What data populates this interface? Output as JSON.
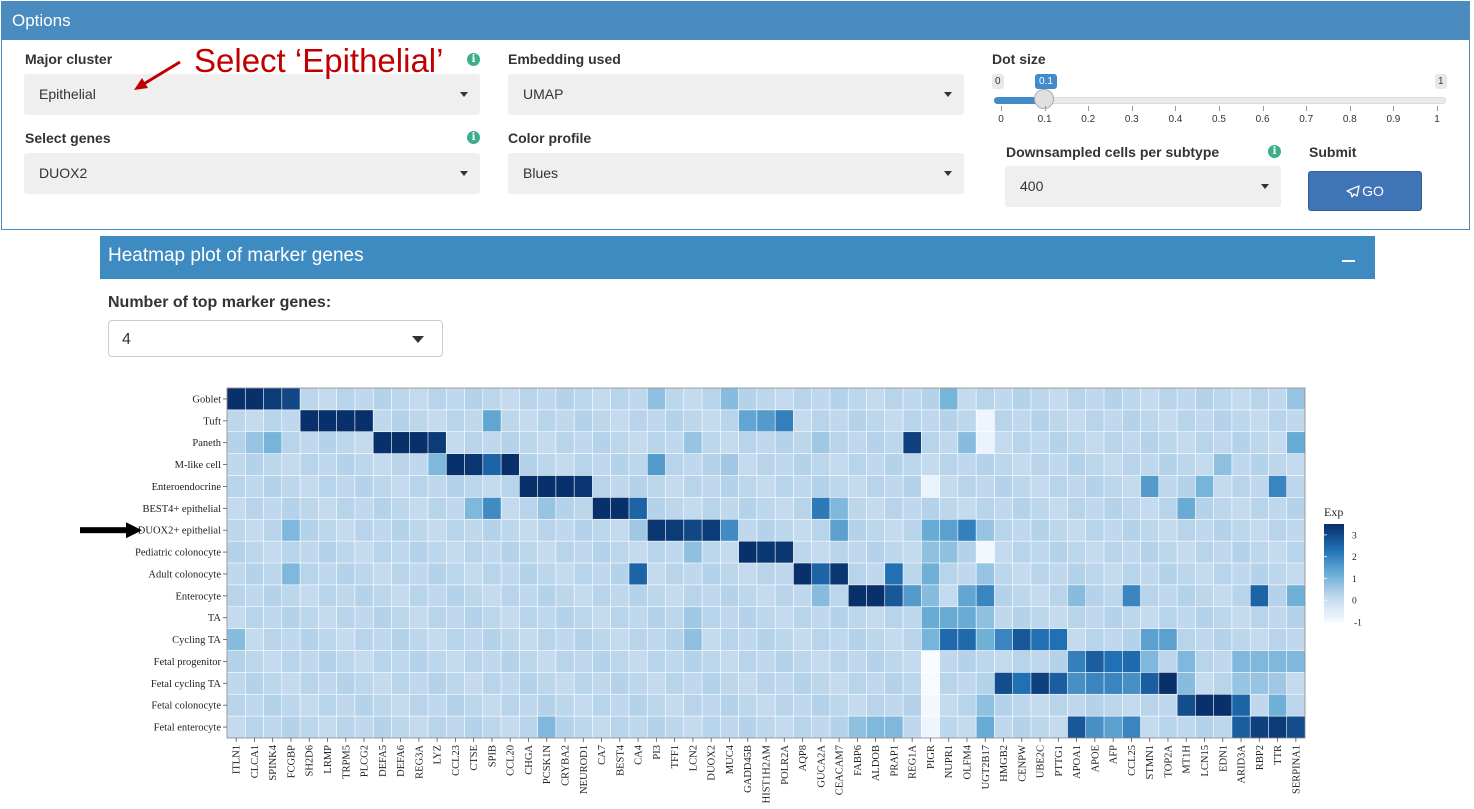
{
  "options": {
    "title": "Options",
    "major_cluster": {
      "label": "Major cluster",
      "value": "Epithelial"
    },
    "annotation": "Select ‘Epithelial’",
    "embedding": {
      "label": "Embedding used",
      "value": "UMAP"
    },
    "dot_size": {
      "label": "Dot size",
      "min": "0",
      "max": "1",
      "current": "0.1",
      "value": 0.1,
      "ticks": [
        "0",
        "0.1",
        "0.2",
        "0.3",
        "0.4",
        "0.5",
        "0.6",
        "0.7",
        "0.8",
        "0.9",
        "1"
      ]
    },
    "select_genes": {
      "label": "Select genes",
      "value": "DUOX2"
    },
    "color_profile": {
      "label": "Color profile",
      "value": "Blues"
    },
    "downsampled": {
      "label": "Downsampled cells per subtype",
      "value": "400"
    },
    "submit": {
      "label": "Submit",
      "button": "GO"
    }
  },
  "heatmap_panel": {
    "title": "Heatmap plot of marker genes",
    "top_markers": {
      "label": "Number of top marker genes:",
      "value": "4"
    }
  },
  "chart_data": {
    "type": "heatmap",
    "legend_title": "Exp",
    "legend_ticks": [
      3,
      2,
      1,
      0,
      -1
    ],
    "value_range": [
      -1,
      3.5
    ],
    "highlighted_row": "DUOX2+ epithelial",
    "rows": [
      "Goblet",
      "Tuft",
      "Paneth",
      "M-like cell",
      "Enteroendocrine",
      "BEST4+ epithelial",
      "DUOX2+ epithelial",
      "Pediatric colonocyte",
      "Adult colonocyte",
      "Enterocyte",
      "TA",
      "Cycling TA",
      "Fetal progenitor",
      "Fetal cycling TA",
      "Fetal colonocyte",
      "Fetal enterocyte"
    ],
    "columns": [
      "ITLN1",
      "CLCA1",
      "SPINK4",
      "FCGBP",
      "SH2D6",
      "LRMP",
      "TRPM5",
      "PLCG2",
      "DEFA5",
      "DEFA6",
      "REG3A",
      "LYZ",
      "CCL23",
      "CTSE",
      "SPIB",
      "CCL20",
      "CHGA",
      "PCSK1N",
      "CRYBA2",
      "NEUROD1",
      "CA7",
      "BEST4",
      "CA4",
      "PI3",
      "TFF1",
      "LCN2",
      "DUOX2",
      "MUC4",
      "GADD45B",
      "HIST1H2AM",
      "POLR2A",
      "AQP8",
      "GUCA2A",
      "CEACAM7",
      "FABP6",
      "ALDOB",
      "PRAP1",
      "REG1A",
      "PIGR",
      "NUPR1",
      "OLFM4",
      "UGT2B17",
      "HMGB2",
      "CENPW",
      "UBE2C",
      "PTTG1",
      "APOA1",
      "APOE",
      "AFP",
      "CCL25",
      "STMN1",
      "TOP2A",
      "MT1H",
      "LCN15",
      "EDN1",
      "ARID3A",
      "RBP2",
      "TTR",
      "SERPINA1"
    ],
    "high_cells": [
      [
        0,
        0,
        3.5
      ],
      [
        0,
        1,
        3.5
      ],
      [
        0,
        2,
        3.3
      ],
      [
        0,
        3,
        3.1
      ],
      [
        0,
        23,
        0.8
      ],
      [
        0,
        27,
        0.9
      ],
      [
        0,
        39,
        1.1
      ],
      [
        0,
        58,
        0.7
      ],
      [
        1,
        4,
        3.5
      ],
      [
        1,
        5,
        3.5
      ],
      [
        1,
        6,
        3.5
      ],
      [
        1,
        7,
        3.5
      ],
      [
        1,
        14,
        1.4
      ],
      [
        1,
        28,
        1.4
      ],
      [
        1,
        29,
        1.6
      ],
      [
        1,
        30,
        2.1
      ],
      [
        2,
        1,
        0.7
      ],
      [
        2,
        2,
        1.1
      ],
      [
        2,
        8,
        3.5
      ],
      [
        2,
        9,
        3.5
      ],
      [
        2,
        10,
        3.5
      ],
      [
        2,
        11,
        3.3
      ],
      [
        2,
        25,
        0.7
      ],
      [
        2,
        32,
        0.6
      ],
      [
        2,
        37,
        3.2
      ],
      [
        2,
        40,
        0.9
      ],
      [
        2,
        58,
        1.3
      ],
      [
        3,
        11,
        1.0
      ],
      [
        3,
        12,
        3.5
      ],
      [
        3,
        13,
        3.4
      ],
      [
        3,
        14,
        2.6
      ],
      [
        3,
        15,
        3.5
      ],
      [
        3,
        23,
        1.6
      ],
      [
        3,
        27,
        0.6
      ],
      [
        3,
        54,
        0.8
      ],
      [
        4,
        16,
        3.5
      ],
      [
        4,
        17,
        3.5
      ],
      [
        4,
        18,
        3.5
      ],
      [
        4,
        19,
        3.4
      ],
      [
        4,
        50,
        1.6
      ],
      [
        4,
        53,
        1.1
      ],
      [
        4,
        57,
        2.0
      ],
      [
        5,
        13,
        1.0
      ],
      [
        5,
        14,
        1.9
      ],
      [
        5,
        17,
        0.7
      ],
      [
        5,
        20,
        3.5
      ],
      [
        5,
        21,
        3.5
      ],
      [
        5,
        22,
        2.6
      ],
      [
        5,
        32,
        2.2
      ],
      [
        5,
        33,
        1.0
      ],
      [
        5,
        52,
        1.3
      ],
      [
        6,
        3,
        1.0
      ],
      [
        6,
        22,
        0.6
      ],
      [
        6,
        23,
        3.4
      ],
      [
        6,
        24,
        3.3
      ],
      [
        6,
        25,
        3.1
      ],
      [
        6,
        26,
        3.3
      ],
      [
        6,
        27,
        1.9
      ],
      [
        6,
        33,
        1.5
      ],
      [
        6,
        38,
        1.3
      ],
      [
        6,
        39,
        1.5
      ],
      [
        6,
        40,
        2.1
      ],
      [
        6,
        41,
        0.7
      ],
      [
        7,
        25,
        0.8
      ],
      [
        7,
        28,
        3.5
      ],
      [
        7,
        29,
        3.4
      ],
      [
        7,
        30,
        3.4
      ],
      [
        7,
        38,
        0.8
      ],
      [
        7,
        39,
        0.8
      ],
      [
        8,
        3,
        1.0
      ],
      [
        8,
        22,
        2.6
      ],
      [
        8,
        31,
        3.5
      ],
      [
        8,
        32,
        2.6
      ],
      [
        8,
        33,
        3.4
      ],
      [
        8,
        36,
        2.4
      ],
      [
        8,
        38,
        1.2
      ],
      [
        8,
        41,
        0.7
      ],
      [
        9,
        32,
        0.9
      ],
      [
        9,
        34,
        3.5
      ],
      [
        9,
        35,
        3.5
      ],
      [
        9,
        36,
        2.8
      ],
      [
        9,
        37,
        1.6
      ],
      [
        9,
        38,
        0.9
      ],
      [
        9,
        40,
        1.4
      ],
      [
        9,
        41,
        2.0
      ],
      [
        9,
        46,
        0.9
      ],
      [
        9,
        49,
        2.0
      ],
      [
        9,
        56,
        2.6
      ],
      [
        9,
        58,
        1.2
      ],
      [
        10,
        25,
        0.6
      ],
      [
        10,
        38,
        1.3
      ],
      [
        10,
        39,
        1.3
      ],
      [
        10,
        40,
        1.3
      ],
      [
        10,
        41,
        1.4
      ],
      [
        11,
        0,
        0.9
      ],
      [
        11,
        25,
        0.8
      ],
      [
        11,
        38,
        1.1
      ],
      [
        11,
        39,
        2.5
      ],
      [
        11,
        40,
        2.5
      ],
      [
        11,
        41,
        1.2
      ],
      [
        11,
        42,
        2.0
      ],
      [
        11,
        43,
        2.8
      ],
      [
        11,
        44,
        2.4
      ],
      [
        11,
        45,
        2.4
      ],
      [
        11,
        50,
        1.5
      ],
      [
        11,
        51,
        1.5
      ],
      [
        12,
        46,
        2.1
      ],
      [
        12,
        47,
        2.7
      ],
      [
        12,
        48,
        2.4
      ],
      [
        12,
        49,
        2.5
      ],
      [
        12,
        50,
        1.0
      ],
      [
        12,
        52,
        1.0
      ],
      [
        12,
        55,
        1.0
      ],
      [
        12,
        56,
        1.0
      ],
      [
        12,
        57,
        1.0
      ],
      [
        12,
        58,
        1.0
      ],
      [
        13,
        42,
        3.0
      ],
      [
        13,
        43,
        2.4
      ],
      [
        13,
        44,
        3.2
      ],
      [
        13,
        45,
        2.7
      ],
      [
        13,
        46,
        1.8
      ],
      [
        13,
        47,
        2.0
      ],
      [
        13,
        48,
        2.0
      ],
      [
        13,
        49,
        1.8
      ],
      [
        13,
        50,
        2.7
      ],
      [
        13,
        51,
        3.5
      ],
      [
        13,
        52,
        0.9
      ],
      [
        13,
        55,
        0.7
      ],
      [
        13,
        56,
        0.7
      ],
      [
        13,
        57,
        0.6
      ],
      [
        14,
        41,
        0.8
      ],
      [
        14,
        52,
        3.0
      ],
      [
        14,
        53,
        3.5
      ],
      [
        14,
        54,
        3.5
      ],
      [
        14,
        55,
        2.6
      ],
      [
        14,
        57,
        1.2
      ],
      [
        15,
        17,
        1.0
      ],
      [
        15,
        34,
        0.8
      ],
      [
        15,
        35,
        1.0
      ],
      [
        15,
        36,
        1.0
      ],
      [
        15,
        41,
        1.3
      ],
      [
        15,
        46,
        2.8
      ],
      [
        15,
        47,
        1.8
      ],
      [
        15,
        48,
        1.5
      ],
      [
        15,
        49,
        2.0
      ],
      [
        15,
        55,
        2.7
      ],
      [
        15,
        56,
        3.2
      ],
      [
        15,
        57,
        3.3
      ],
      [
        15,
        58,
        3.0
      ]
    ],
    "low_cells": [
      [
        10,
        41,
        0.8
      ],
      [
        12,
        38,
        -1.0
      ],
      [
        13,
        38,
        -1.0
      ],
      [
        14,
        38,
        -0.9
      ],
      [
        15,
        38,
        -0.8
      ],
      [
        4,
        38,
        -0.7
      ],
      [
        7,
        41,
        -0.9
      ],
      [
        1,
        41,
        -0.8
      ],
      [
        2,
        41,
        -0.7
      ]
    ]
  }
}
